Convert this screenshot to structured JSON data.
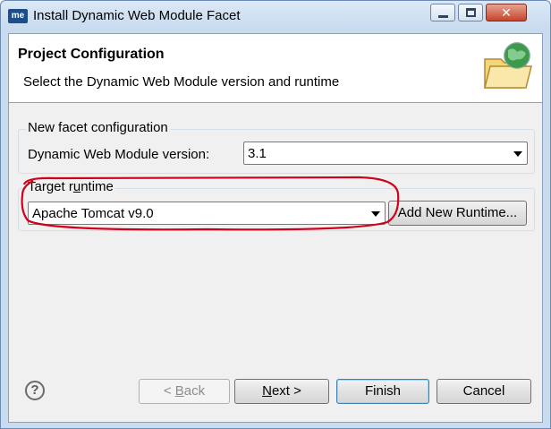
{
  "window": {
    "app_icon_text": "me",
    "title": "Install Dynamic Web Module Facet",
    "controls": {
      "minimize_icon": "minimize-icon",
      "maximize_icon": "maximize-icon",
      "close_glyph": "✕"
    }
  },
  "banner": {
    "title": "Project Configuration",
    "description": "Select the Dynamic Web Module version and runtime",
    "icon": "folder-globe-icon"
  },
  "facet_group": {
    "legend": "New facet configuration",
    "version_label": "Dynamic Web Module version:",
    "version_value": "3.1"
  },
  "runtime_group": {
    "legend_parts": [
      "Target r",
      "u",
      "ntime"
    ],
    "runtime_value": "Apache Tomcat v9.0",
    "add_button": "Add New Runtime..."
  },
  "buttons": {
    "help_glyph": "?",
    "back_prefix": "< ",
    "back_mnemonic": "B",
    "back_rest": "ack",
    "next_mnemonic": "N",
    "next_rest": "ext >",
    "finish": "Finish",
    "cancel": "Cancel"
  },
  "colors": {
    "annotation": "#d0021b",
    "default_button_border": "#3c7fb1",
    "window_frame": "#c9dcef"
  }
}
